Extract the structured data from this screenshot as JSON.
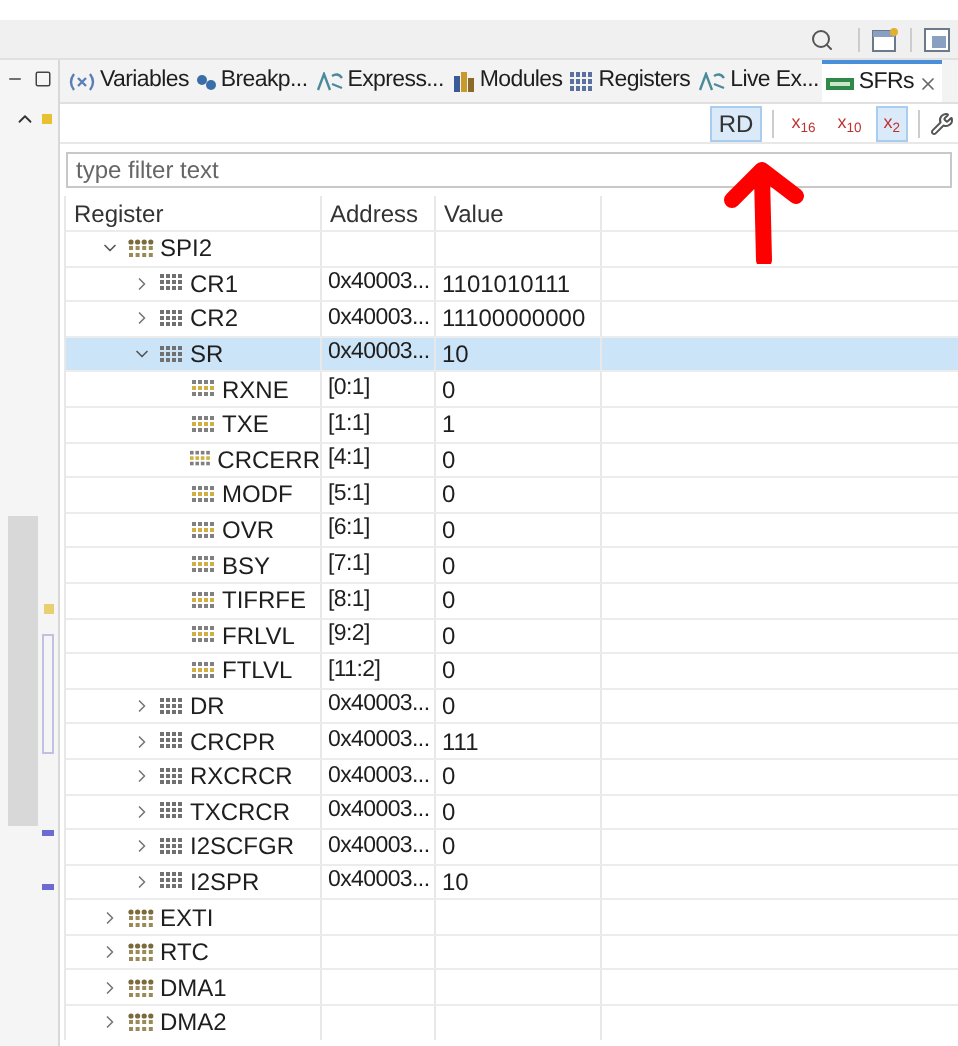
{
  "tabs": [
    {
      "label": "Variables",
      "kind": "variables",
      "selected": false
    },
    {
      "label": "Breakp...",
      "kind": "breakpoints",
      "selected": false
    },
    {
      "label": "Express...",
      "kind": "expressions",
      "selected": false
    },
    {
      "label": "Modules",
      "kind": "modules",
      "selected": false
    },
    {
      "label": "Registers",
      "kind": "registers",
      "selected": false
    },
    {
      "label": "Live Ex...",
      "kind": "expressions",
      "selected": false
    },
    {
      "label": "SFRs",
      "kind": "sfrs",
      "selected": true
    }
  ],
  "view_toolbar": {
    "buttons": [
      {
        "label": "RD",
        "selected": true
      },
      {
        "label": "x$_{16}$",
        "selected": false
      },
      {
        "label": "x$_{10}$",
        "selected": false
      },
      {
        "label": "x$_{2}$",
        "selected": true
      }
    ]
  },
  "filter": {
    "placeholder": "type filter text"
  },
  "table": {
    "columns": [
      "Register",
      "Address",
      "Value"
    ],
    "rows": [
      {
        "name": "SPI2",
        "kind": "peripheral",
        "expanded": true,
        "selected": false,
        "children": [
          {
            "name": "CR1",
            "kind": "register",
            "address": "0x40003...",
            "value": "1101010111",
            "expanded": false,
            "selected": false
          },
          {
            "name": "CR2",
            "kind": "register",
            "address": "0x40003...",
            "value": "11100000000",
            "expanded": false,
            "selected": false
          },
          {
            "name": "SR",
            "kind": "register",
            "address": "0x40003...",
            "value": "10",
            "expanded": true,
            "selected": true,
            "children": [
              {
                "name": "RXNE",
                "kind": "field",
                "address": "[0:1]",
                "value": "0",
                "selected": false
              },
              {
                "name": "TXE",
                "kind": "field",
                "address": "[1:1]",
                "value": "1",
                "selected": false
              },
              {
                "name": "CRCERR",
                "kind": "field",
                "address": "[4:1]",
                "value": "0",
                "selected": false
              },
              {
                "name": "MODF",
                "kind": "field",
                "address": "[5:1]",
                "value": "0",
                "selected": false
              },
              {
                "name": "OVR",
                "kind": "field",
                "address": "[6:1]",
                "value": "0",
                "selected": false
              },
              {
                "name": "BSY",
                "kind": "field",
                "address": "[7:1]",
                "value": "0",
                "selected": false
              },
              {
                "name": "TIFRFE",
                "kind": "field",
                "address": "[8:1]",
                "value": "0",
                "selected": false
              },
              {
                "name": "FRLVL",
                "kind": "field",
                "address": "[9:2]",
                "value": "0",
                "selected": false
              },
              {
                "name": "FTLVL",
                "kind": "field",
                "address": "[11:2]",
                "value": "0",
                "selected": false
              }
            ]
          },
          {
            "name": "DR",
            "kind": "register",
            "address": "0x40003...",
            "value": "0",
            "expanded": false,
            "selected": false
          },
          {
            "name": "CRCPR",
            "kind": "register",
            "address": "0x40003...",
            "value": "111",
            "expanded": false,
            "selected": false
          },
          {
            "name": "RXCRCR",
            "kind": "register",
            "address": "0x40003...",
            "value": "0",
            "expanded": false,
            "selected": false
          },
          {
            "name": "TXCRCR",
            "kind": "register",
            "address": "0x40003...",
            "value": "0",
            "expanded": false,
            "selected": false
          },
          {
            "name": "I2SCFGR",
            "kind": "register",
            "address": "0x40003...",
            "value": "0",
            "expanded": false,
            "selected": false
          },
          {
            "name": "I2SPR",
            "kind": "register",
            "address": "0x40003...",
            "value": "10",
            "expanded": false,
            "selected": false
          }
        ]
      },
      {
        "name": "EXTI",
        "kind": "peripheral",
        "expanded": false,
        "selected": false
      },
      {
        "name": "RTC",
        "kind": "peripheral",
        "expanded": false,
        "selected": false
      },
      {
        "name": "DMA1",
        "kind": "peripheral",
        "expanded": false,
        "selected": false
      },
      {
        "name": "DMA2",
        "kind": "peripheral",
        "expanded": false,
        "selected": false
      }
    ]
  }
}
